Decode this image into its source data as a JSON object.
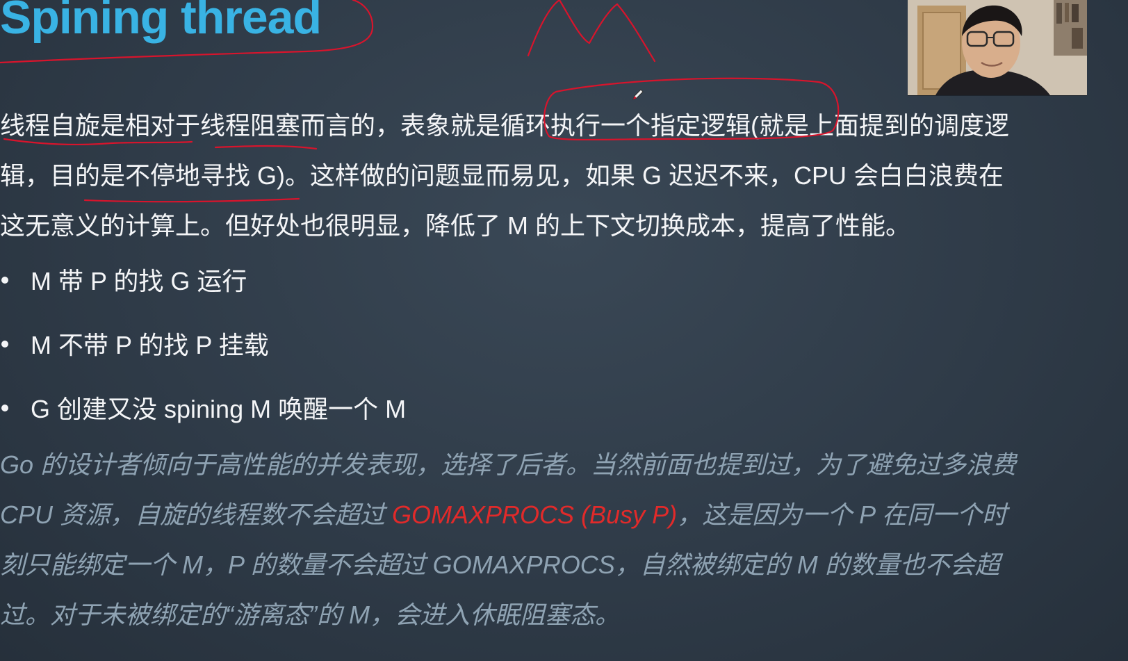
{
  "slide": {
    "title": "Spining thread",
    "paragraph1": [
      "线程自旋是相对于线程阻塞而言的，表象就是循环执行一个指定逻辑(就是上面提到的调度逻",
      "辑，目的是不停地寻找 G)。这样做的问题显而易见，如果 G 迟迟不来，CPU 会白白浪费在",
      "这无意义的计算上。但好处也很明显，降低了 M 的上下文切换成本，提高了性能。"
    ],
    "bullets": [
      "M 带 P 的找 G 运行",
      "M 不带 P 的找 P 挂载",
      "G 创建又没 spining M 唤醒一个 M"
    ],
    "paragraph2": {
      "line1": "Go 的设计者倾向于高性能的并发表现，选择了后者。当然前面也提到过，为了避免过多浪费",
      "line2_before": "CPU 资源，自旋的线程数不会超过 ",
      "line2_highlight": "GOMAXPROCS (Busy P)",
      "line2_after": "，这是因为一个 P 在同一个时",
      "line3": "刻只能绑定一个 M，P 的数量不会超过 GOMAXPROCS，自然被绑定的 M 的数量也不会超",
      "line4": "过。对于未被绑定的“游离态”的 M，会进入休眠阻塞态。"
    }
  },
  "colors": {
    "title": "#39b3e4",
    "body_text": "#f4f5f7",
    "muted_italic": "#8fa3b3",
    "highlight": "#e12a2a",
    "ink": "#d8142c",
    "background": "#323e4b"
  },
  "overlay": {
    "webcam_icon": "webcam-presenter-icon",
    "cursor_icon": "pen-cursor-icon"
  }
}
